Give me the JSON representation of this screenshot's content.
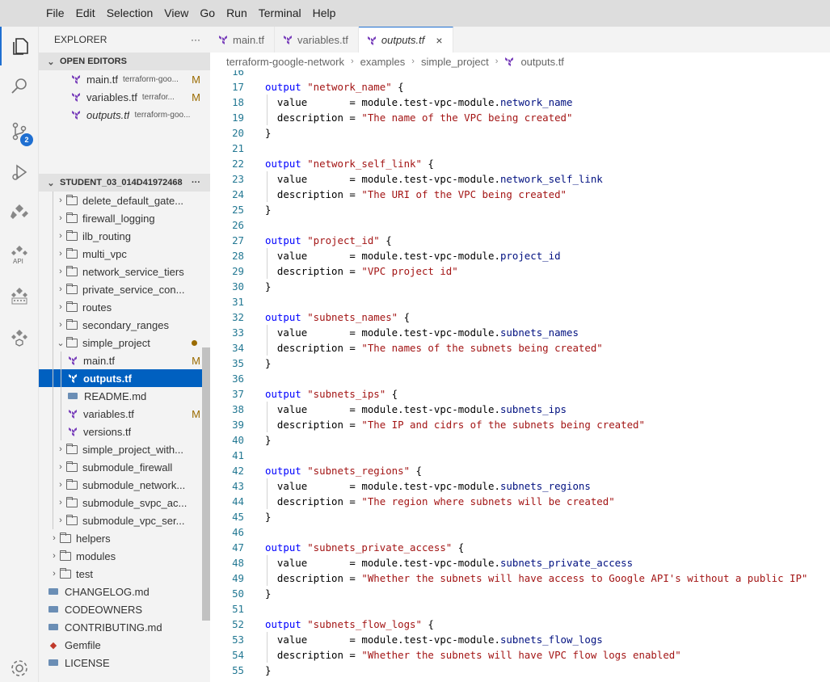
{
  "menu": [
    "File",
    "Edit",
    "Selection",
    "View",
    "Go",
    "Run",
    "Terminal",
    "Help"
  ],
  "activity": {
    "scm_badge": "2",
    "api_label": "API"
  },
  "explorer": {
    "title": "EXPLORER",
    "more": "···",
    "open_editors_label": "OPEN EDITORS",
    "open_editors": [
      {
        "name": "main.tf",
        "path": "terraform-goo...",
        "status": "M"
      },
      {
        "name": "variables.tf",
        "path": "terrafor...",
        "status": "M"
      },
      {
        "name": "outputs.tf",
        "path": "terraform-goo...",
        "status": ""
      }
    ],
    "workspace_label": "STUDENT_03_014D41972468",
    "workspace_more": "···",
    "tree": [
      {
        "name": "delete_default_gate...",
        "type": "folder"
      },
      {
        "name": "firewall_logging",
        "type": "folder"
      },
      {
        "name": "ilb_routing",
        "type": "folder"
      },
      {
        "name": "multi_vpc",
        "type": "folder"
      },
      {
        "name": "network_service_tiers",
        "type": "folder"
      },
      {
        "name": "private_service_con...",
        "type": "folder"
      },
      {
        "name": "routes",
        "type": "folder"
      },
      {
        "name": "secondary_ranges",
        "type": "folder"
      },
      {
        "name": "simple_project",
        "type": "folder-open"
      },
      {
        "name": "main.tf",
        "type": "tf",
        "status": "M"
      },
      {
        "name": "outputs.tf",
        "type": "tf",
        "selected": true
      },
      {
        "name": "README.md",
        "type": "md"
      },
      {
        "name": "variables.tf",
        "type": "tf",
        "status": "M"
      },
      {
        "name": "versions.tf",
        "type": "tf"
      },
      {
        "name": "simple_project_with...",
        "type": "folder"
      },
      {
        "name": "submodule_firewall",
        "type": "folder"
      },
      {
        "name": "submodule_network...",
        "type": "folder"
      },
      {
        "name": "submodule_svpc_ac...",
        "type": "folder"
      },
      {
        "name": "submodule_vpc_ser...",
        "type": "folder"
      },
      {
        "name": "helpers",
        "type": "folder"
      },
      {
        "name": "modules",
        "type": "folder"
      },
      {
        "name": "test",
        "type": "folder"
      },
      {
        "name": "CHANGELOG.md",
        "type": "md"
      },
      {
        "name": "CODEOWNERS",
        "type": "md"
      },
      {
        "name": "CONTRIBUTING.md",
        "type": "md"
      },
      {
        "name": "Gemfile",
        "type": "gem"
      },
      {
        "name": "LICENSE",
        "type": "md"
      }
    ]
  },
  "tabs": [
    {
      "label": "main.tf",
      "active": false
    },
    {
      "label": "variables.tf",
      "active": false
    },
    {
      "label": "outputs.tf",
      "active": true,
      "close": "×"
    }
  ],
  "breadcrumbs": [
    "terraform-google-network",
    "examples",
    "simple_project",
    "outputs.tf"
  ],
  "editor": {
    "first_line": 16,
    "lines": [
      [
        {
          "t": ""
        }
      ],
      [
        {
          "t": "output ",
          "c": "k"
        },
        {
          "t": "\"network_name\"",
          "c": "s"
        },
        {
          "t": " {"
        }
      ],
      [
        {
          "t": "  value       = module.test-vpc-module.",
          "i": 1
        },
        {
          "t": "network_name",
          "c": "vr"
        }
      ],
      [
        {
          "t": "  description = ",
          "i": 1
        },
        {
          "t": "\"The name of the VPC being created\"",
          "c": "s"
        }
      ],
      [
        {
          "t": "}"
        }
      ],
      [
        {
          "t": ""
        }
      ],
      [
        {
          "t": "output ",
          "c": "k"
        },
        {
          "t": "\"network_self_link\"",
          "c": "s"
        },
        {
          "t": " {"
        }
      ],
      [
        {
          "t": "  value       = module.test-vpc-module.",
          "i": 1
        },
        {
          "t": "network_self_link",
          "c": "vr"
        }
      ],
      [
        {
          "t": "  description = ",
          "i": 1
        },
        {
          "t": "\"The URI of the VPC being created\"",
          "c": "s"
        }
      ],
      [
        {
          "t": "}"
        }
      ],
      [
        {
          "t": ""
        }
      ],
      [
        {
          "t": "output ",
          "c": "k"
        },
        {
          "t": "\"project_id\"",
          "c": "s"
        },
        {
          "t": " {"
        }
      ],
      [
        {
          "t": "  value       = module.test-vpc-module.",
          "i": 1
        },
        {
          "t": "project_id",
          "c": "vr"
        }
      ],
      [
        {
          "t": "  description = ",
          "i": 1
        },
        {
          "t": "\"VPC project id\"",
          "c": "s"
        }
      ],
      [
        {
          "t": "}"
        }
      ],
      [
        {
          "t": ""
        }
      ],
      [
        {
          "t": "output ",
          "c": "k"
        },
        {
          "t": "\"subnets_names\"",
          "c": "s"
        },
        {
          "t": " {"
        }
      ],
      [
        {
          "t": "  value       = module.test-vpc-module.",
          "i": 1
        },
        {
          "t": "subnets_names",
          "c": "vr"
        }
      ],
      [
        {
          "t": "  description = ",
          "i": 1
        },
        {
          "t": "\"The names of the subnets being created\"",
          "c": "s"
        }
      ],
      [
        {
          "t": "}"
        }
      ],
      [
        {
          "t": ""
        }
      ],
      [
        {
          "t": "output ",
          "c": "k"
        },
        {
          "t": "\"subnets_ips\"",
          "c": "s"
        },
        {
          "t": " {"
        }
      ],
      [
        {
          "t": "  value       = module.test-vpc-module.",
          "i": 1
        },
        {
          "t": "subnets_ips",
          "c": "vr"
        }
      ],
      [
        {
          "t": "  description = ",
          "i": 1
        },
        {
          "t": "\"The IP and cidrs of the subnets being created\"",
          "c": "s"
        }
      ],
      [
        {
          "t": "}"
        }
      ],
      [
        {
          "t": ""
        }
      ],
      [
        {
          "t": "output ",
          "c": "k"
        },
        {
          "t": "\"subnets_regions\"",
          "c": "s"
        },
        {
          "t": " {"
        }
      ],
      [
        {
          "t": "  value       = module.test-vpc-module.",
          "i": 1
        },
        {
          "t": "subnets_regions",
          "c": "vr"
        }
      ],
      [
        {
          "t": "  description = ",
          "i": 1
        },
        {
          "t": "\"The region where subnets will be created\"",
          "c": "s"
        }
      ],
      [
        {
          "t": "}"
        }
      ],
      [
        {
          "t": ""
        }
      ],
      [
        {
          "t": "output ",
          "c": "k"
        },
        {
          "t": "\"subnets_private_access\"",
          "c": "s"
        },
        {
          "t": " {"
        }
      ],
      [
        {
          "t": "  value       = module.test-vpc-module.",
          "i": 1
        },
        {
          "t": "subnets_private_access",
          "c": "vr"
        }
      ],
      [
        {
          "t": "  description = ",
          "i": 1
        },
        {
          "t": "\"Whether the subnets will have access to Google API's without a public IP\"",
          "c": "s"
        }
      ],
      [
        {
          "t": "}"
        }
      ],
      [
        {
          "t": ""
        }
      ],
      [
        {
          "t": "output ",
          "c": "k"
        },
        {
          "t": "\"subnets_flow_logs\"",
          "c": "s"
        },
        {
          "t": " {"
        }
      ],
      [
        {
          "t": "  value       = module.test-vpc-module.",
          "i": 1
        },
        {
          "t": "subnets_flow_logs",
          "c": "vr"
        }
      ],
      [
        {
          "t": "  description = ",
          "i": 1
        },
        {
          "t": "\"Whether the subnets will have VPC flow logs enabled\"",
          "c": "s"
        }
      ],
      [
        {
          "t": "}"
        }
      ]
    ]
  },
  "colors": {
    "accent": "#1f6fd1",
    "selection": "#0060c0",
    "modified": "#9a6b00",
    "keyword": "#0000ff",
    "string": "#a31515",
    "attr": "#001080",
    "terraform": "#7b42bc"
  }
}
